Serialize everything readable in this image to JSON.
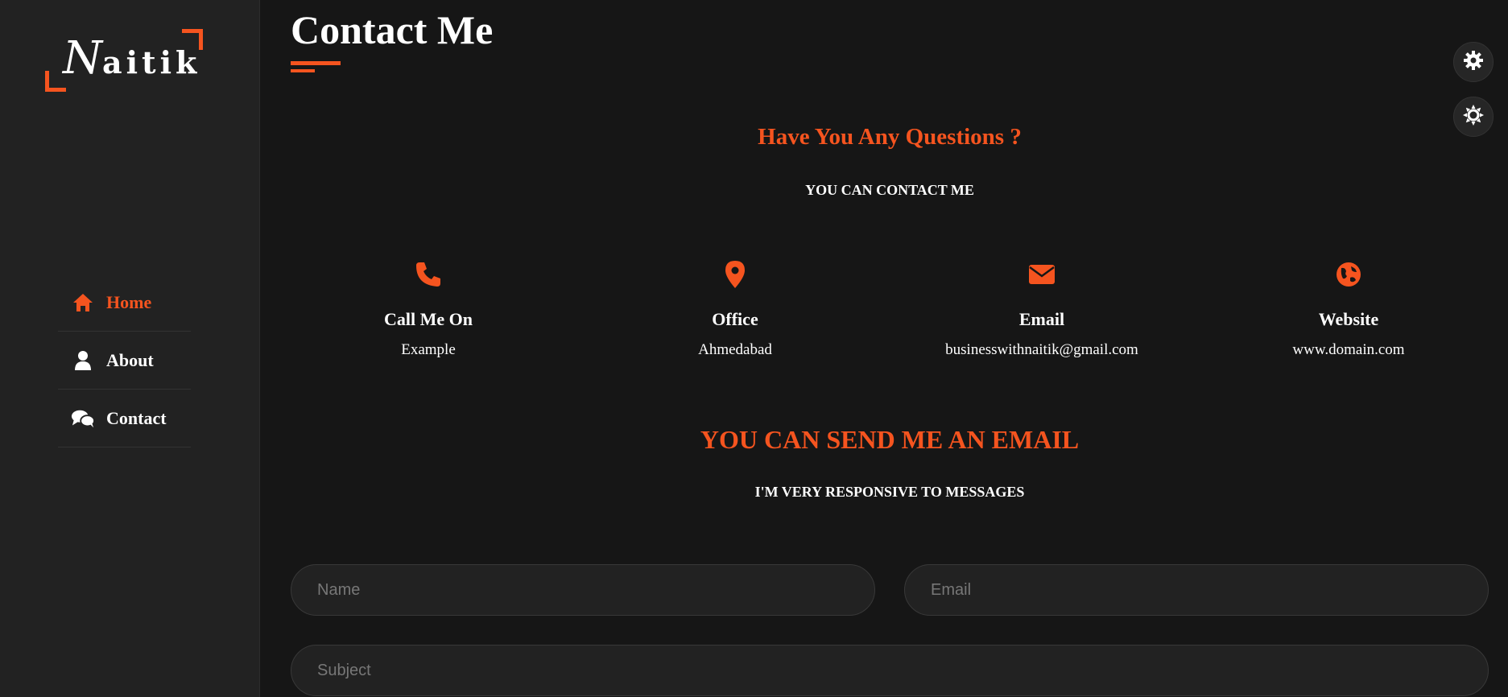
{
  "logo": {
    "first": "N",
    "rest": "aitik"
  },
  "nav": [
    {
      "label": "Home",
      "icon": "home-icon",
      "active": true
    },
    {
      "label": "About",
      "icon": "user-icon",
      "active": false
    },
    {
      "label": "Contact",
      "icon": "comments-icon",
      "active": false
    }
  ],
  "page": {
    "title": "Contact Me"
  },
  "questions": {
    "heading": "Have You Any Questions ?",
    "sub": "YOU CAN CONTACT ME"
  },
  "info": [
    {
      "icon": "phone-icon",
      "title": "Call Me On",
      "value": "Example"
    },
    {
      "icon": "location-pin-icon",
      "title": "Office",
      "value": "Ahmedabad"
    },
    {
      "icon": "envelope-icon",
      "title": "Email",
      "value": "businesswithnaitik@gmail.com"
    },
    {
      "icon": "globe-icon",
      "title": "Website",
      "value": "www.domain.com"
    }
  ],
  "send": {
    "heading": "YOU CAN SEND ME AN EMAIL",
    "sub": "I'M VERY RESPONSIVE TO MESSAGES"
  },
  "form": {
    "name_placeholder": "Name",
    "email_placeholder": "Email",
    "subject_placeholder": "Subject"
  },
  "colors": {
    "accent": "#f5541f",
    "background": "#161616",
    "sidebar": "#222222"
  }
}
